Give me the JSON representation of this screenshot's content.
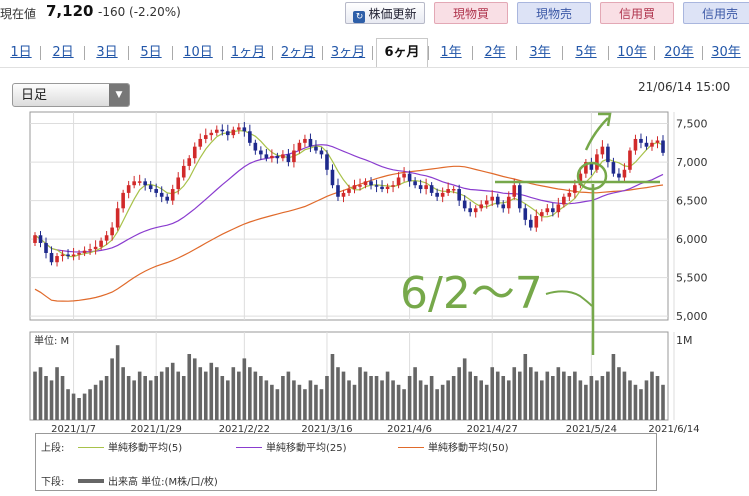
{
  "header": {
    "price_label": "現在値",
    "price_value": "7,120",
    "price_change": "-160 (-2.20%)",
    "refresh_icon": "refresh-icon",
    "refresh_label": "株価更新",
    "buy_spot": "現物買",
    "sell_spot": "現物売",
    "buy_margin": "信用買",
    "sell_margin": "信用売"
  },
  "tabs": [
    "1日",
    "2日",
    "3日",
    "5日",
    "10日",
    "1ヶ月",
    "2ヶ月",
    "3ヶ月",
    "6ヶ月",
    "1年",
    "2年",
    "3年",
    "5年",
    "10年",
    "20年",
    "30年"
  ],
  "active_tab": "6ヶ月",
  "controls": {
    "timeframe": "日足",
    "timestamp": "21/06/14 15:00"
  },
  "colors": {
    "up": "#d12a2a",
    "down": "#1f2a8c",
    "ma5": "#a8c24a",
    "ma25": "#8a3ccf",
    "ma50": "#e06a2b",
    "volume": "#666666",
    "annotation": "#76a84a"
  },
  "annotation": {
    "text": "6/2〜7"
  },
  "chart_data": [
    {
      "type": "candlestick",
      "title": "",
      "ylim": [
        4950,
        7650
      ],
      "y_ticks": [
        "7,500",
        "7,000",
        "6,500",
        "6,000",
        "5,500",
        "5,000"
      ],
      "y_tick_values": [
        7500,
        7000,
        6500,
        6000,
        5500,
        5000
      ],
      "x_tick_labels": [
        "2021/1/7",
        "2021/1/29",
        "2021/2/22",
        "2021/3/16",
        "2021/4/6",
        "2021/4/27",
        "2021/5/24",
        "2021/6/14"
      ],
      "x_tick_index": [
        7,
        22,
        38,
        53,
        68,
        83,
        101,
        116
      ],
      "close": [
        6050,
        5950,
        5820,
        5700,
        5780,
        5800,
        5780,
        5800,
        5820,
        5850,
        5870,
        5900,
        5980,
        6050,
        6150,
        6400,
        6600,
        6700,
        6750,
        6750,
        6700,
        6650,
        6600,
        6550,
        6500,
        6650,
        6800,
        6950,
        7050,
        7200,
        7300,
        7350,
        7380,
        7420,
        7400,
        7350,
        7420,
        7450,
        7400,
        7250,
        7150,
        7100,
        7050,
        7080,
        7050,
        7100,
        7000,
        7150,
        7250,
        7300,
        7200,
        7150,
        7100,
        6900,
        6700,
        6550,
        6600,
        6650,
        6700,
        6700,
        6750,
        6700,
        6680,
        6650,
        6680,
        6700,
        6800,
        6850,
        6750,
        6700,
        6650,
        6700,
        6600,
        6550,
        6600,
        6650,
        6650,
        6500,
        6400,
        6350,
        6400,
        6450,
        6500,
        6550,
        6450,
        6400,
        6550,
        6700,
        6400,
        6250,
        6150,
        6300,
        6350,
        6400,
        6350,
        6450,
        6550,
        6600,
        6700,
        6850,
        7000,
        6900,
        7100,
        7200,
        7000,
        6850,
        6800,
        6900,
        7150,
        7300,
        7250,
        7200,
        7250,
        7280,
        7120
      ],
      "open": [
        5950,
        6050,
        5950,
        5820,
        5700,
        5780,
        5800,
        5780,
        5800,
        5820,
        5850,
        5870,
        5900,
        5980,
        6050,
        6150,
        6400,
        6600,
        6700,
        6750,
        6750,
        6700,
        6650,
        6600,
        6550,
        6500,
        6650,
        6800,
        6950,
        7050,
        7200,
        7300,
        7350,
        7380,
        7420,
        7400,
        7350,
        7420,
        7450,
        7400,
        7250,
        7150,
        7100,
        7050,
        7080,
        7050,
        7100,
        7000,
        7150,
        7250,
        7300,
        7200,
        7150,
        7100,
        6900,
        6700,
        6550,
        6600,
        6650,
        6700,
        6700,
        6750,
        6700,
        6680,
        6650,
        6680,
        6700,
        6800,
        6850,
        6750,
        6700,
        6650,
        6700,
        6600,
        6550,
        6600,
        6650,
        6650,
        6500,
        6400,
        6350,
        6400,
        6450,
        6500,
        6550,
        6450,
        6400,
        6550,
        6700,
        6400,
        6250,
        6150,
        6300,
        6350,
        6400,
        6350,
        6450,
        6550,
        6600,
        6700,
        6850,
        7000,
        6900,
        7100,
        7200,
        7000,
        6850,
        6800,
        6900,
        7150,
        7300,
        7250,
        7200,
        7250,
        7280
      ],
      "series": [
        {
          "name": "単純移動平均(5)",
          "color_key": "ma5"
        },
        {
          "name": "単純移動平均(25)",
          "color_key": "ma25"
        },
        {
          "name": "単純移動平均(50)",
          "color_key": "ma50"
        }
      ]
    },
    {
      "type": "bar",
      "ylabel": "単位: M",
      "y_tick": "1M",
      "values": [
        0.55,
        0.6,
        0.5,
        0.45,
        0.6,
        0.5,
        0.35,
        0.3,
        0.25,
        0.3,
        0.35,
        0.4,
        0.45,
        0.5,
        0.7,
        0.85,
        0.6,
        0.5,
        0.45,
        0.55,
        0.5,
        0.45,
        0.5,
        0.55,
        0.6,
        0.65,
        0.55,
        0.5,
        0.75,
        0.7,
        0.6,
        0.55,
        0.65,
        0.6,
        0.5,
        0.45,
        0.6,
        0.55,
        0.7,
        0.6,
        0.55,
        0.5,
        0.45,
        0.4,
        0.35,
        0.5,
        0.55,
        0.45,
        0.4,
        0.35,
        0.45,
        0.4,
        0.35,
        0.5,
        0.75,
        0.6,
        0.55,
        0.45,
        0.4,
        0.6,
        0.55,
        0.5,
        0.5,
        0.45,
        0.55,
        0.45,
        0.4,
        0.35,
        0.5,
        0.6,
        0.45,
        0.4,
        0.5,
        0.35,
        0.4,
        0.45,
        0.5,
        0.6,
        0.7,
        0.55,
        0.5,
        0.45,
        0.4,
        0.6,
        0.55,
        0.5,
        0.45,
        0.6,
        0.55,
        0.75,
        0.6,
        0.55,
        0.45,
        0.55,
        0.5,
        0.6,
        0.55,
        0.5,
        0.55,
        0.45,
        0.4,
        0.5,
        0.45,
        0.5,
        0.55,
        0.75,
        0.6,
        0.55,
        0.45,
        0.4,
        0.35,
        0.45,
        0.55,
        0.5,
        0.4
      ]
    }
  ],
  "legend": {
    "upper_label": "上段:",
    "ma5": "単純移動平均(5)",
    "ma25": "単純移動平均(25)",
    "ma50": "単純移動平均(50)",
    "lower_label": "下段:",
    "volume": "出来高 単位:(M株/口/枚)"
  }
}
